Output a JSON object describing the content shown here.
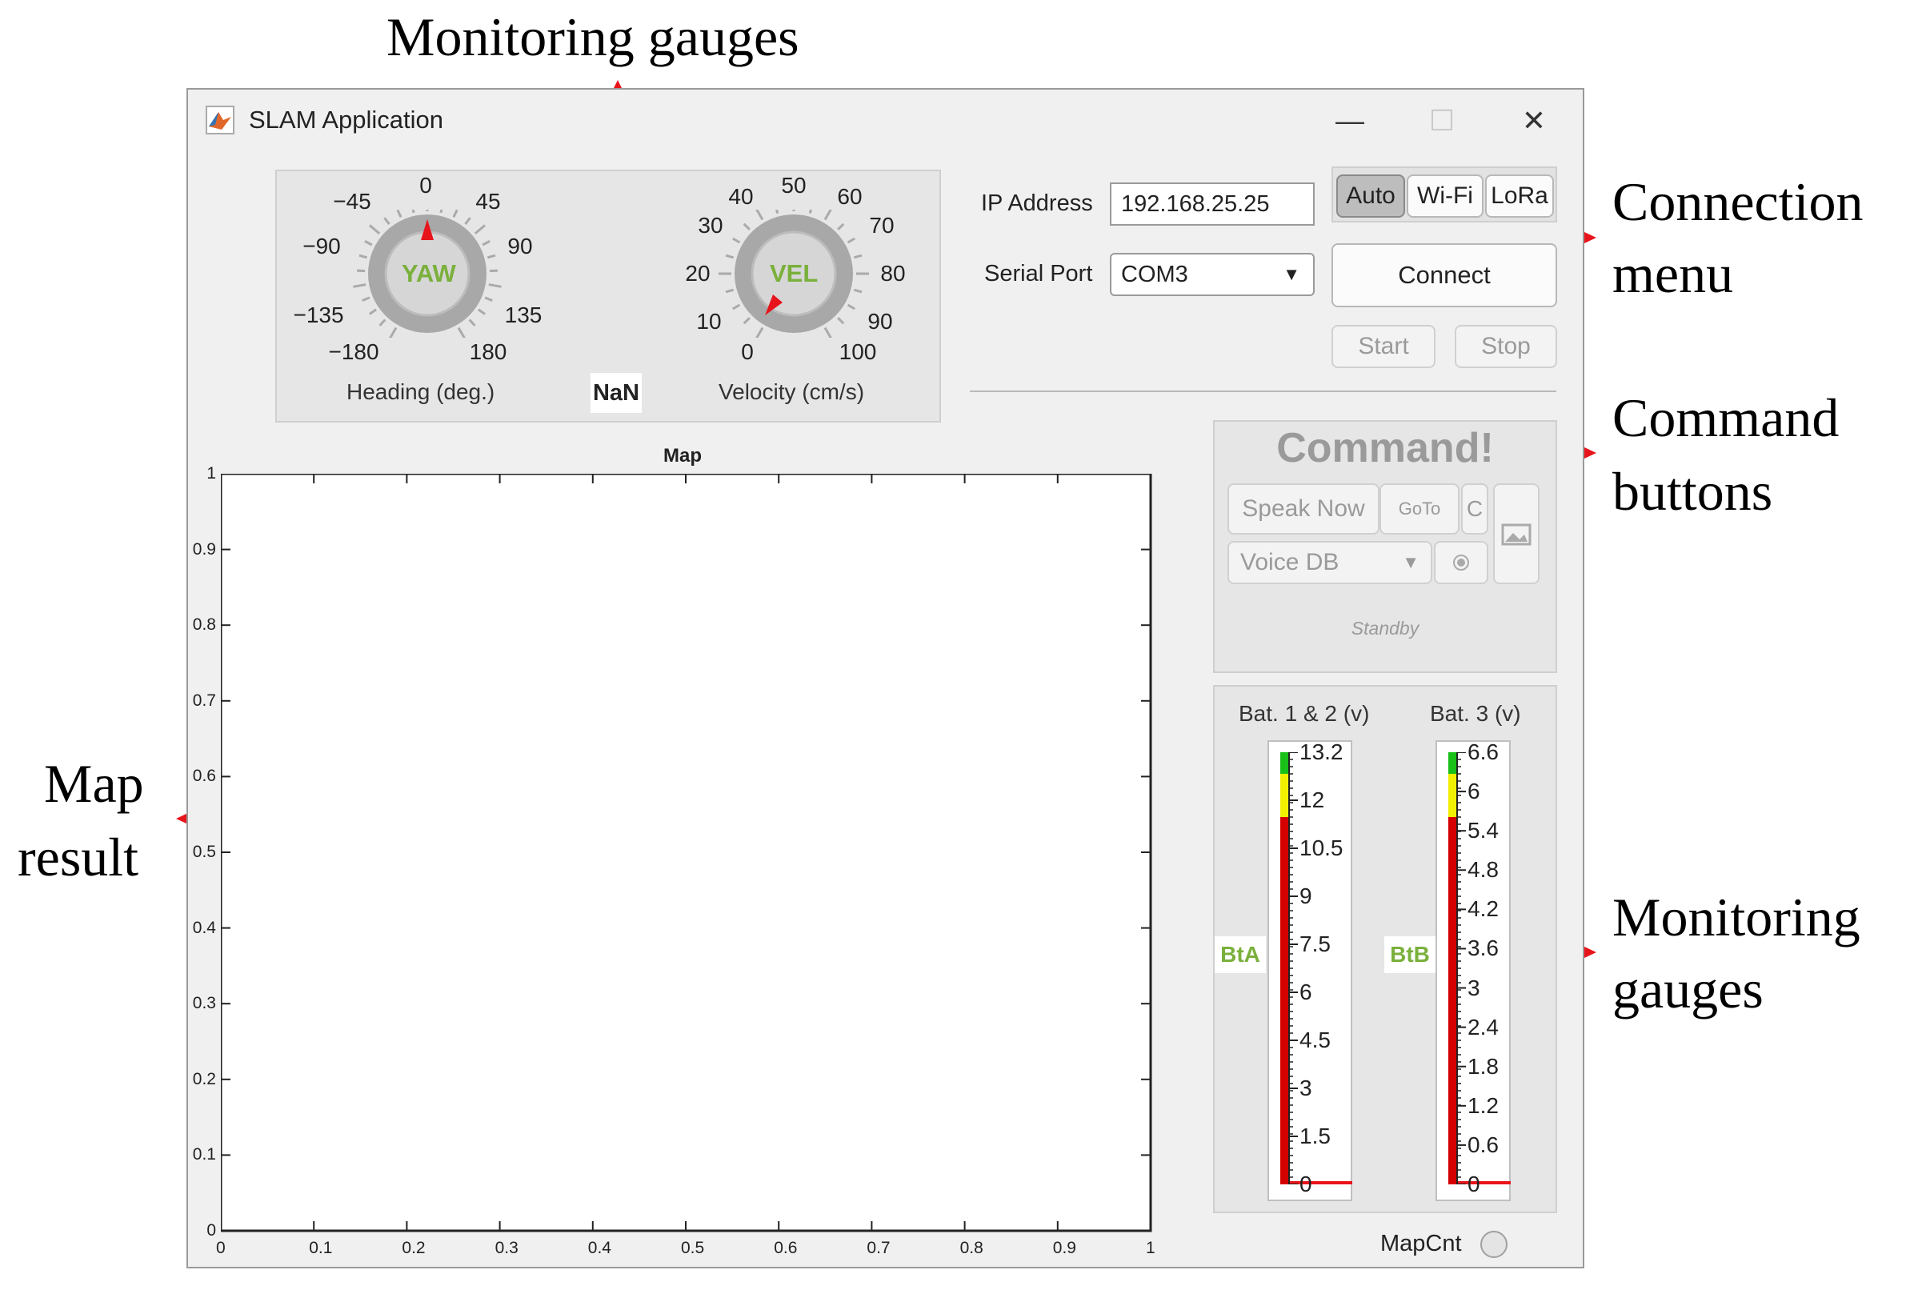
{
  "annotations": {
    "top": "Monitoring gauges",
    "connection": [
      "Connection",
      "menu"
    ],
    "command": [
      "Command",
      "buttons"
    ],
    "map": [
      "Map",
      "result"
    ],
    "bottom": [
      "Monitoring",
      "gauges"
    ]
  },
  "window": {
    "title": "SLAM Application",
    "minimize": "—",
    "maximize": "☐",
    "close": "✕"
  },
  "yaw_gauge": {
    "center_label": "YAW",
    "caption": "Heading (deg.)",
    "ticks": [
      "0",
      "45",
      "90",
      "135",
      "180",
      "−180",
      "−135",
      "−90",
      "−45"
    ],
    "value": 0
  },
  "nan_readout": "NaN",
  "vel_gauge": {
    "center_label": "VEL",
    "caption": "Velocity (cm/s)",
    "ticks": [
      "0",
      "10",
      "20",
      "30",
      "40",
      "50",
      "60",
      "70",
      "80",
      "90",
      "100"
    ],
    "value": 0
  },
  "connection": {
    "ip_label": "IP Address",
    "ip_value": "192.168.25.25",
    "serial_label": "Serial Port",
    "serial_value": "COM3",
    "mode_buttons": [
      "Auto",
      "Wi-Fi",
      "LoRa"
    ],
    "selected_mode": "Auto",
    "connect": "Connect",
    "start": "Start",
    "stop": "Stop"
  },
  "command": {
    "title": "Command!",
    "speak_now": "Speak Now",
    "goto": "GoTo",
    "c": "C",
    "voice_db": "Voice DB",
    "status": "Standby"
  },
  "map": {
    "title": "Map",
    "x_ticks": [
      "0",
      "0.1",
      "0.2",
      "0.3",
      "0.4",
      "0.5",
      "0.6",
      "0.7",
      "0.8",
      "0.9",
      "1"
    ],
    "y_ticks": [
      "0",
      "0.1",
      "0.2",
      "0.3",
      "0.4",
      "0.5",
      "0.6",
      "0.7",
      "0.8",
      "0.9",
      "1"
    ]
  },
  "batteries": {
    "bat12": {
      "caption": "Bat. 1 & 2 (v)",
      "label": "BtA",
      "ticks": [
        "13.2",
        "12",
        "10.5",
        "9",
        "7.5",
        "6",
        "4.5",
        "3",
        "1.5",
        "0"
      ],
      "value": 0
    },
    "bat3": {
      "caption": "Bat. 3 (v)",
      "label": "BtB",
      "ticks": [
        "6.6",
        "6",
        "5.4",
        "4.8",
        "4.2",
        "3.6",
        "3",
        "2.4",
        "1.8",
        "1.2",
        "0.6",
        "0"
      ],
      "value": 0
    }
  },
  "mapcnt_label": "MapCnt",
  "colors": {
    "arrow": "#e8141b",
    "gauge_label_green": "#7ab03b",
    "bar_green": "#18c018",
    "bar_yellow": "#f0f000",
    "bar_red": "#d40000"
  }
}
